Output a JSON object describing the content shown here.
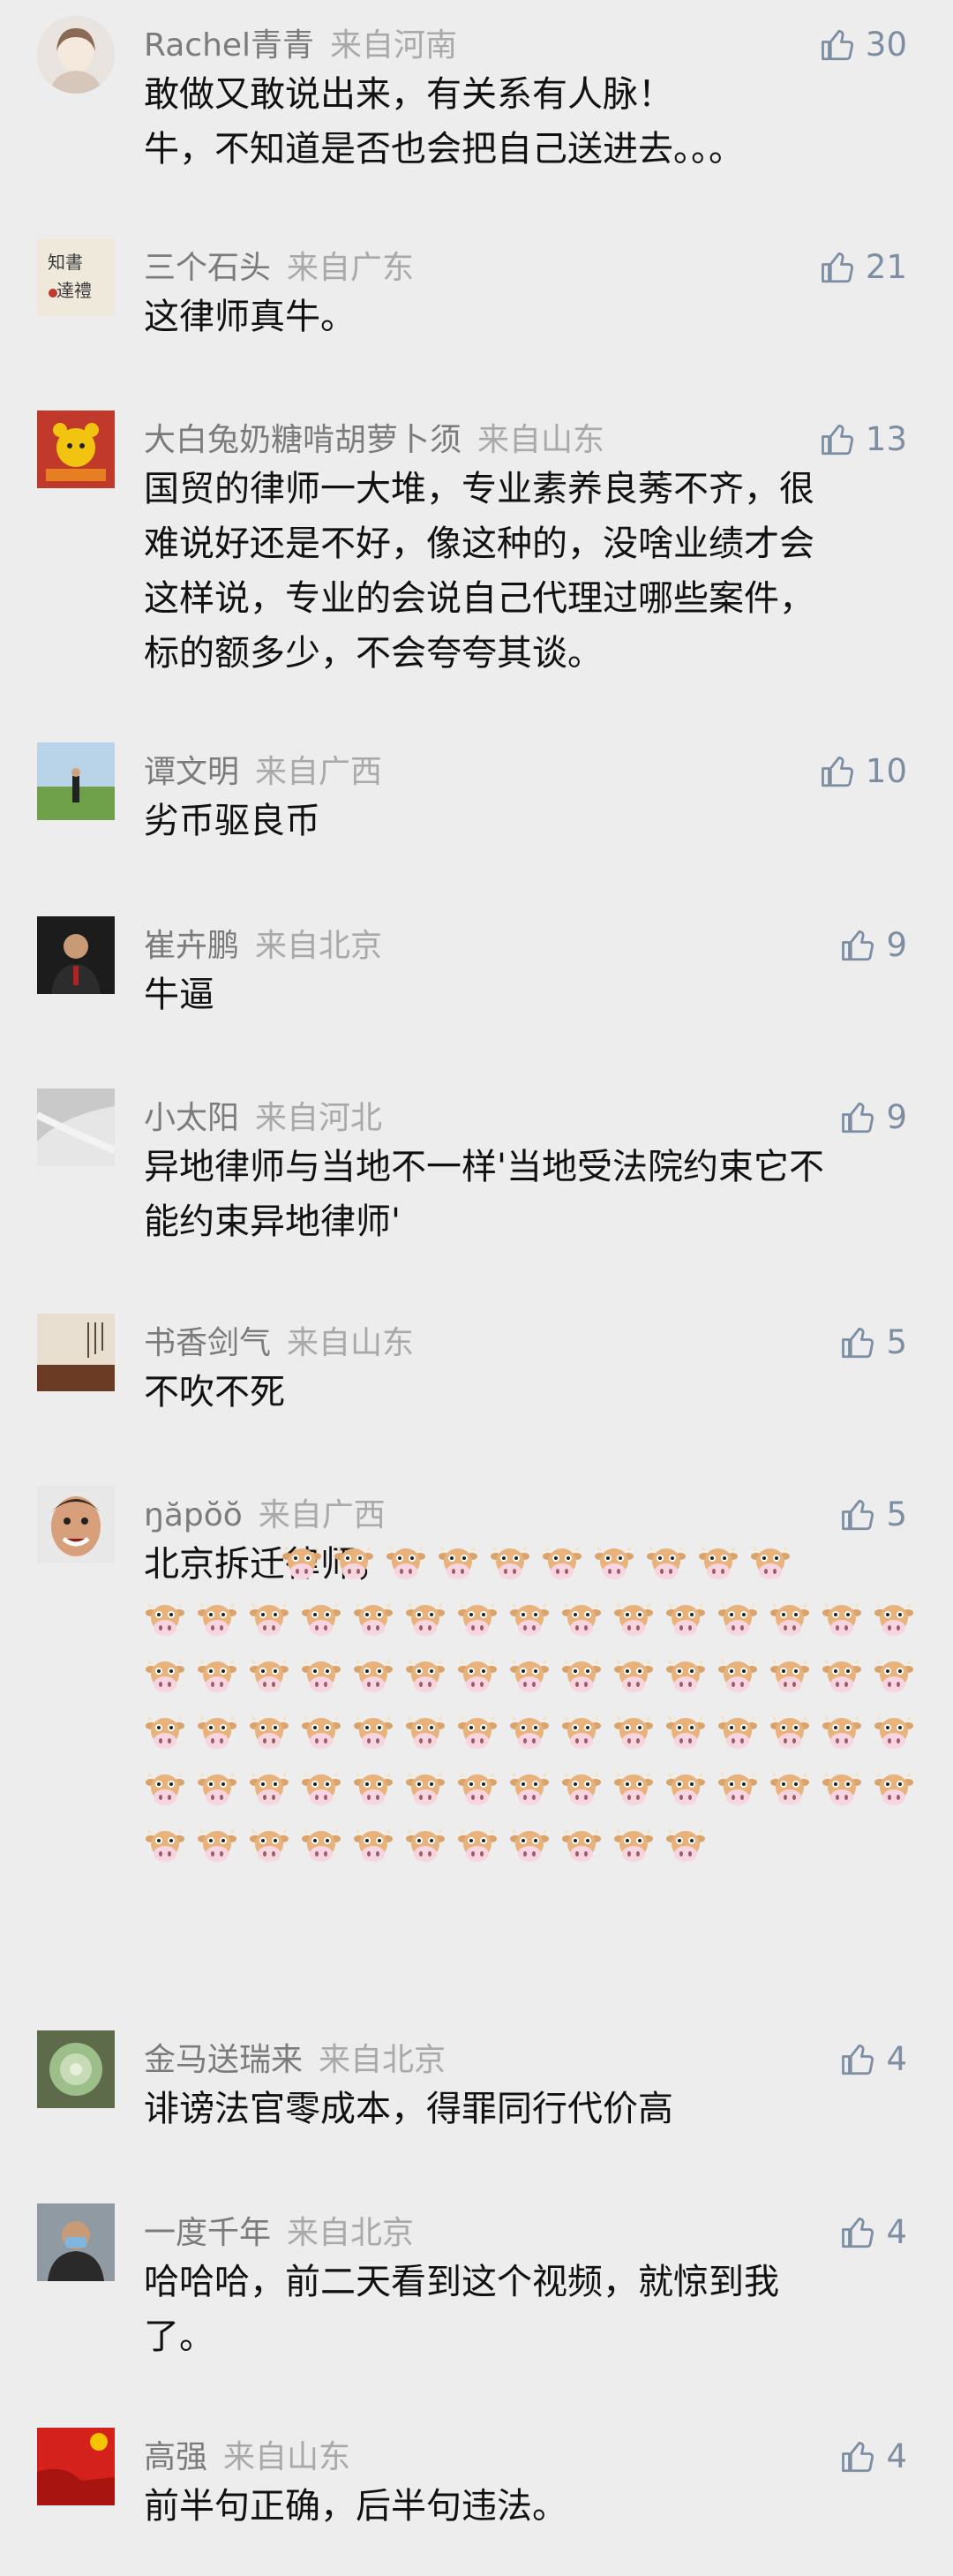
{
  "comments": [
    {
      "name": "Rachel青青",
      "location": "来自河南",
      "likes": "30",
      "lines": [
        "敢做又敢说出来，有关系有人脉！",
        "牛，不知道是否也会把自己送进去。。。"
      ]
    },
    {
      "name": "三个石头",
      "location": "来自广东",
      "likes": "21",
      "lines": [
        "这律师真牛。"
      ]
    },
    {
      "name": "大白兔奶糖啃胡萝卜须",
      "location": "来自山东",
      "likes": "13",
      "lines": [
        "国贸的律师一大堆，专业素养良莠不齐，很",
        "难说好还是不好，像这种的，没啥业绩才会",
        "这样说，专业的会说自己代理过哪些案件，",
        "标的额多少，不会夸夸其谈。"
      ]
    },
    {
      "name": "谭文明",
      "location": "来自广西",
      "likes": "10",
      "lines": [
        "劣币驱良币"
      ]
    },
    {
      "name": "崔卉鹏",
      "location": "来自北京",
      "likes": "9",
      "lines": [
        "牛逼"
      ]
    },
    {
      "name": "小太阳",
      "location": "来自河北",
      "likes": "9",
      "lines": [
        "异地律师与当地不一样'当地受法院约束它不",
        "能约束异地律师'"
      ]
    },
    {
      "name": "书香剑气",
      "location": "来自山东",
      "likes": "5",
      "lines": [
        "不吹不死"
      ]
    },
    {
      "name": "ŋăpŏŏ",
      "location": "来自广西",
      "likes": "5",
      "lines": [
        "北京拆迁律师，"
      ],
      "emoji_label": "cow-face",
      "emoji_count": 81
    },
    {
      "name": "金马送瑞来",
      "location": "来自北京",
      "likes": "4",
      "lines": [
        "诽谤法官零成本，得罪同行代价高"
      ]
    },
    {
      "name": "一度千年",
      "location": "来自北京",
      "likes": "4",
      "lines": [
        "哈哈哈，前二天看到这个视频，就惊到我",
        "了。"
      ]
    },
    {
      "name": "高强",
      "location": "来自山东",
      "likes": "4",
      "lines": [
        "前半句正确，后半句违法。"
      ]
    }
  ],
  "colors": {
    "background": "#ededed",
    "name": "#7b7b7b",
    "location": "#a9a9a9",
    "like": "#7d8ea3",
    "text": "#111111"
  }
}
